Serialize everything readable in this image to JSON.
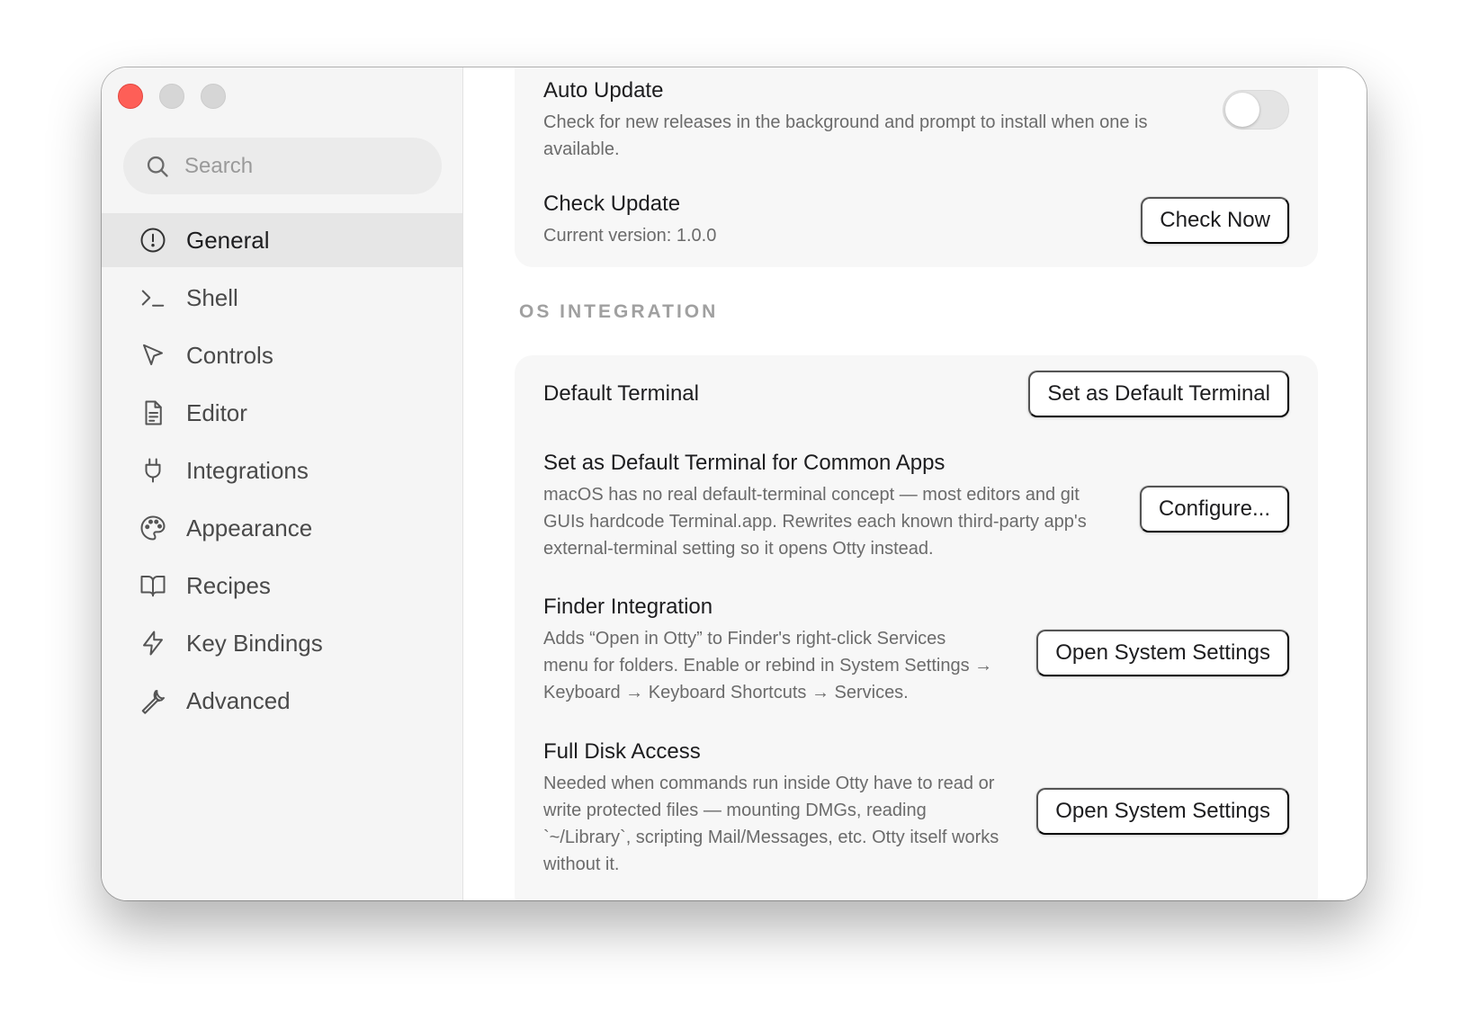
{
  "search": {
    "placeholder": "Search"
  },
  "sidebar": {
    "items": [
      {
        "label": "General",
        "icon": "info-circle-icon",
        "active": true
      },
      {
        "label": "Shell",
        "icon": "terminal-prompt-icon"
      },
      {
        "label": "Controls",
        "icon": "pointer-arrow-icon"
      },
      {
        "label": "Editor",
        "icon": "document-icon"
      },
      {
        "label": "Integrations",
        "icon": "plug-icon"
      },
      {
        "label": "Appearance",
        "icon": "palette-icon"
      },
      {
        "label": "Recipes",
        "icon": "book-icon"
      },
      {
        "label": "Key Bindings",
        "icon": "lightning-icon"
      },
      {
        "label": "Advanced",
        "icon": "wrench-icon"
      }
    ]
  },
  "updates": {
    "auto_update": {
      "title": "Auto Update",
      "description": "Check for new releases in the background and prompt to install when one is available.",
      "enabled": false
    },
    "check_update": {
      "title": "Check Update",
      "description": "Current version: 1.0.0",
      "button": "Check Now"
    }
  },
  "os_integration": {
    "title": "OS INTEGRATION",
    "default_terminal": {
      "title": "Default Terminal",
      "button": "Set as Default Terminal"
    },
    "common_apps": {
      "title": "Set as Default Terminal for Common Apps",
      "description": "macOS has no real default-terminal concept — most editors and git GUIs hardcode Terminal.app. Rewrites each known third-party app's external-terminal setting so it opens Otty instead.",
      "button": "Configure..."
    },
    "finder": {
      "title": "Finder Integration",
      "description": "Adds “Open in Otty” to Finder's right-click Services menu for folders. Enable or rebind in System Settings → Keyboard → Keyboard Shortcuts → Services.",
      "button": "Open System Settings"
    },
    "full_disk": {
      "title": "Full Disk Access",
      "description": "Needed when commands run inside Otty have to read or write protected files — mounting DMGs, reading `~/Library`, scripting Mail/Messages, etc. Otty itself works without it.",
      "button": "Open System Settings"
    }
  },
  "colors": {
    "close": "#fe5f57",
    "sidebar_bg": "#f5f5f5",
    "card_bg": "#f7f7f7",
    "active_item_bg": "#e6e6e6"
  }
}
